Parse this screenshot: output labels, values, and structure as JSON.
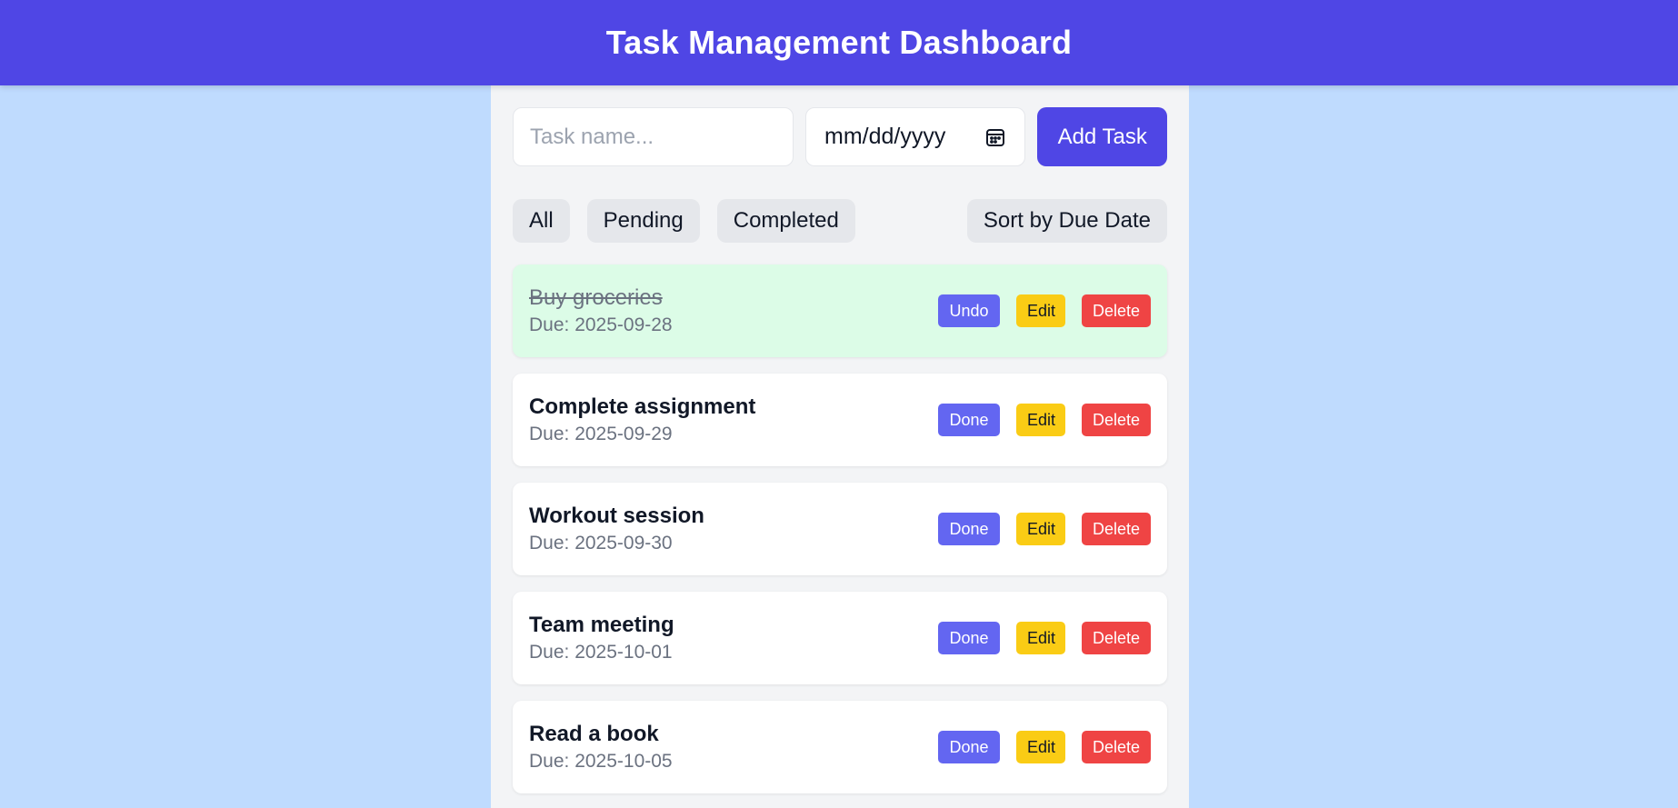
{
  "header": {
    "title": "Task Management Dashboard"
  },
  "form": {
    "task_placeholder": "Task name...",
    "task_value": "",
    "date_placeholder": "mm/dd/yyyy",
    "add_label": "Add Task",
    "calendar_icon": "calendar-icon"
  },
  "filters": {
    "all": "All",
    "pending": "Pending",
    "completed": "Completed",
    "sort": "Sort by Due Date"
  },
  "tasks": [
    {
      "title": "Buy groceries",
      "due": "Due: 2025-09-28",
      "completed": true,
      "primary_label": "Undo",
      "edit_label": "Edit",
      "delete_label": "Delete"
    },
    {
      "title": "Complete assignment",
      "due": "Due: 2025-09-29",
      "completed": false,
      "primary_label": "Done",
      "edit_label": "Edit",
      "delete_label": "Delete"
    },
    {
      "title": "Workout session",
      "due": "Due: 2025-09-30",
      "completed": false,
      "primary_label": "Done",
      "edit_label": "Edit",
      "delete_label": "Delete"
    },
    {
      "title": "Team meeting",
      "due": "Due: 2025-10-01",
      "completed": false,
      "primary_label": "Done",
      "edit_label": "Edit",
      "delete_label": "Delete"
    },
    {
      "title": "Read a book",
      "due": "Due: 2025-10-05",
      "completed": false,
      "primary_label": "Done",
      "edit_label": "Edit",
      "delete_label": "Delete"
    }
  ],
  "colors": {
    "accent": "#4f46e5",
    "page_bg": "#bfdbfe",
    "completed_bg": "#dcfce7",
    "done_button": "#6366f1",
    "edit_button": "#facc15",
    "delete_button": "#ef4444"
  }
}
